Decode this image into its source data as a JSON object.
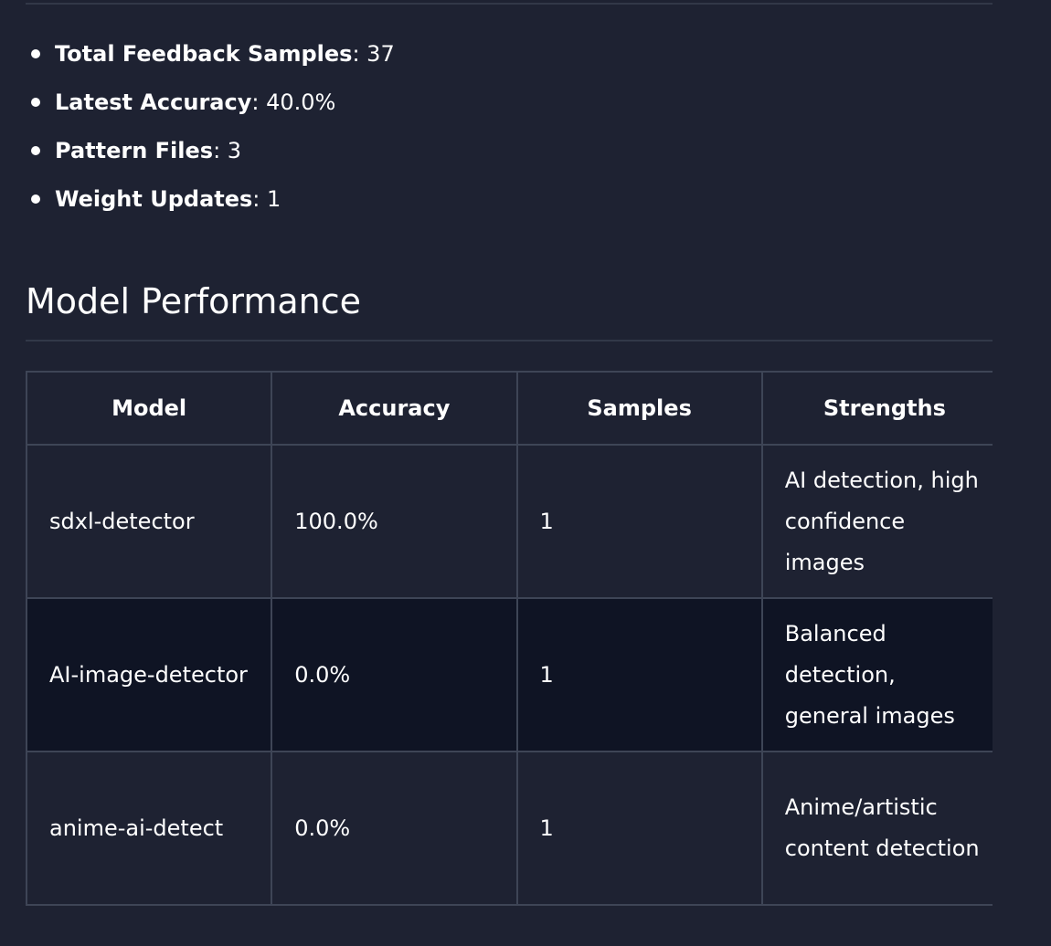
{
  "stats": {
    "items": [
      {
        "label": "Total Feedback Samples",
        "value": "37"
      },
      {
        "label": "Latest Accuracy",
        "value": "40.0%"
      },
      {
        "label": "Pattern Files",
        "value": "3"
      },
      {
        "label": "Weight Updates",
        "value": "1"
      }
    ]
  },
  "performance": {
    "title": "Model Performance",
    "headers": [
      "Model",
      "Accuracy",
      "Samples",
      "Strengths"
    ],
    "rows": [
      {
        "model": "sdxl-detector",
        "accuracy": "100.0%",
        "samples": "1",
        "strengths": "AI detection, high confidence images"
      },
      {
        "model": "AI-image-detector",
        "accuracy": "0.0%",
        "samples": "1",
        "strengths": "Balanced detection, general images"
      },
      {
        "model": "anime-ai-detect",
        "accuracy": "0.0%",
        "samples": "1",
        "strengths": "Anime/artistic content detection"
      }
    ]
  },
  "colors": {
    "background": "#1e2232",
    "alt_row": "#0f1424",
    "border": "#3e4556",
    "text": "#ffffff"
  }
}
